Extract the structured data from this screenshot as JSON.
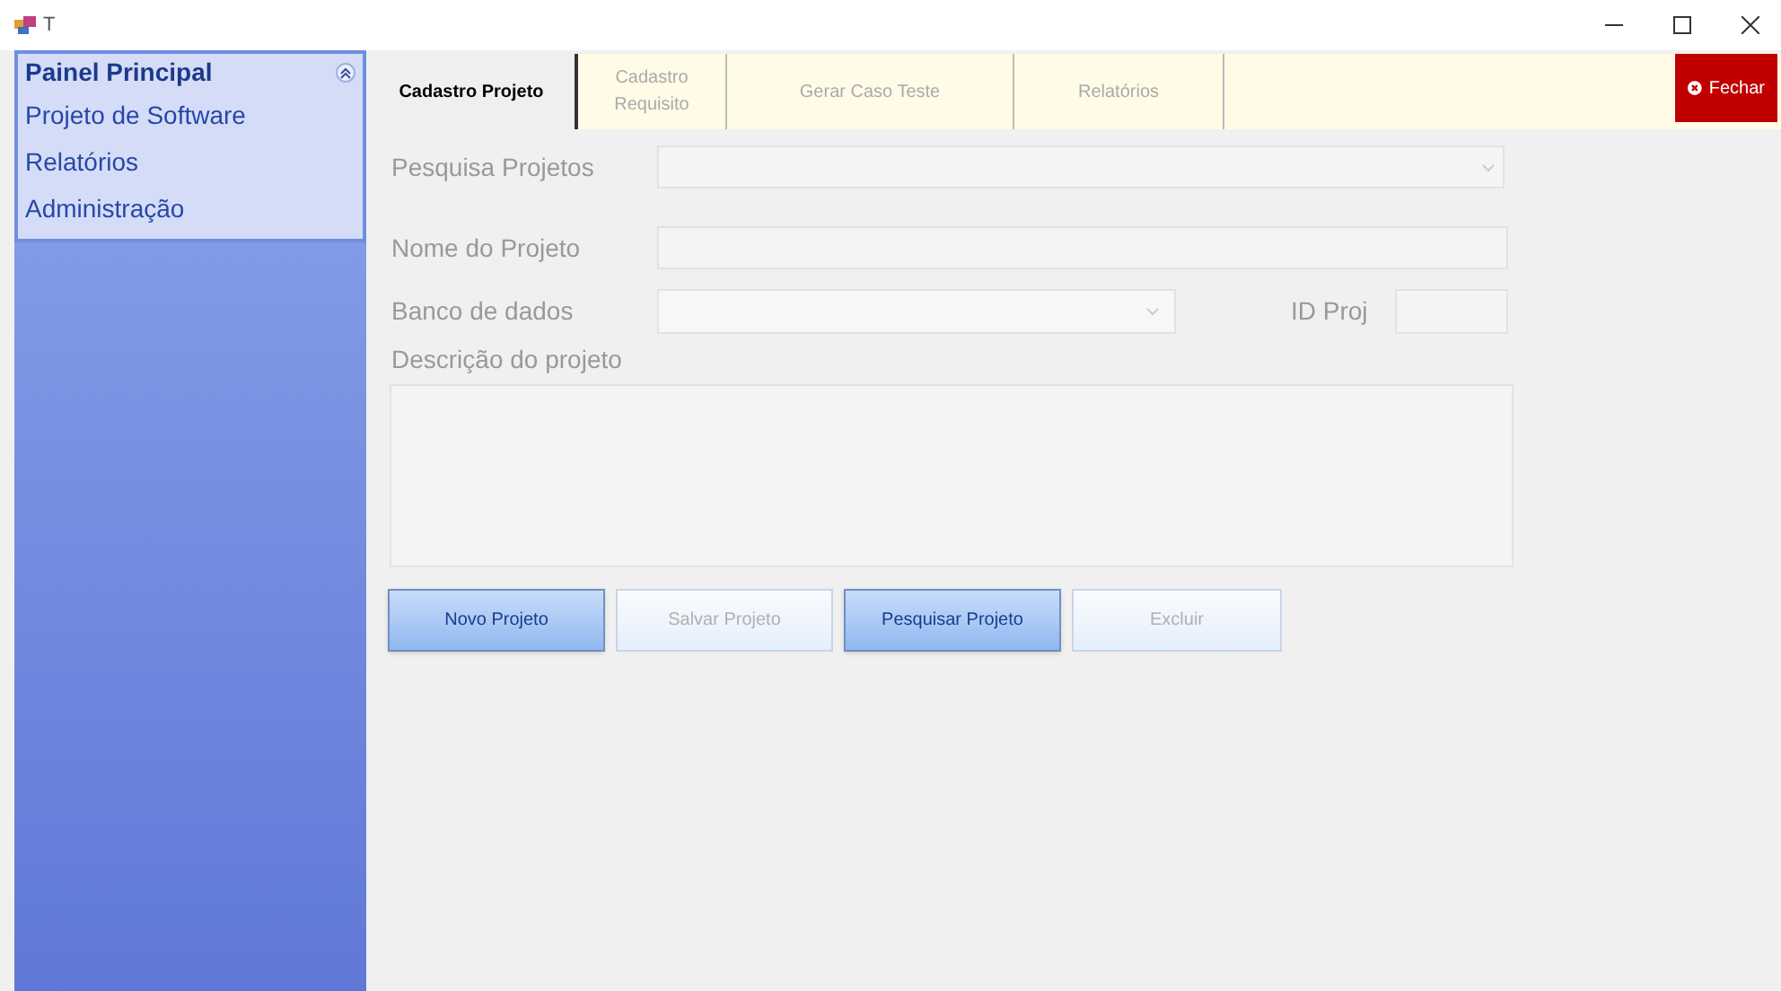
{
  "window": {
    "title": "T"
  },
  "sidebar": {
    "header": "Painel Principal",
    "expanded": true,
    "items": [
      "Projeto de Software",
      "Relatórios",
      "Administração"
    ]
  },
  "tabs": [
    {
      "label": "Cadastro Projeto",
      "selected": true
    },
    {
      "label": "Cadastro Requisito",
      "selected": false
    },
    {
      "label": "Gerar Caso Teste",
      "selected": false
    },
    {
      "label": "Relatórios",
      "selected": false
    }
  ],
  "close_button": "Fechar",
  "form": {
    "search_label": "Pesquisa Projetos",
    "name_label": "Nome do Projeto",
    "database_label": "Banco de dados",
    "id_label": "ID Proj",
    "description_label": "Descrição do projeto"
  },
  "buttons": [
    {
      "label": "Novo Projeto",
      "disabled": false
    },
    {
      "label": "Salvar Projeto",
      "disabled": true
    },
    {
      "label": "Pesquisar Projeto",
      "disabled": false
    },
    {
      "label": "Excluir",
      "disabled": true
    }
  ]
}
